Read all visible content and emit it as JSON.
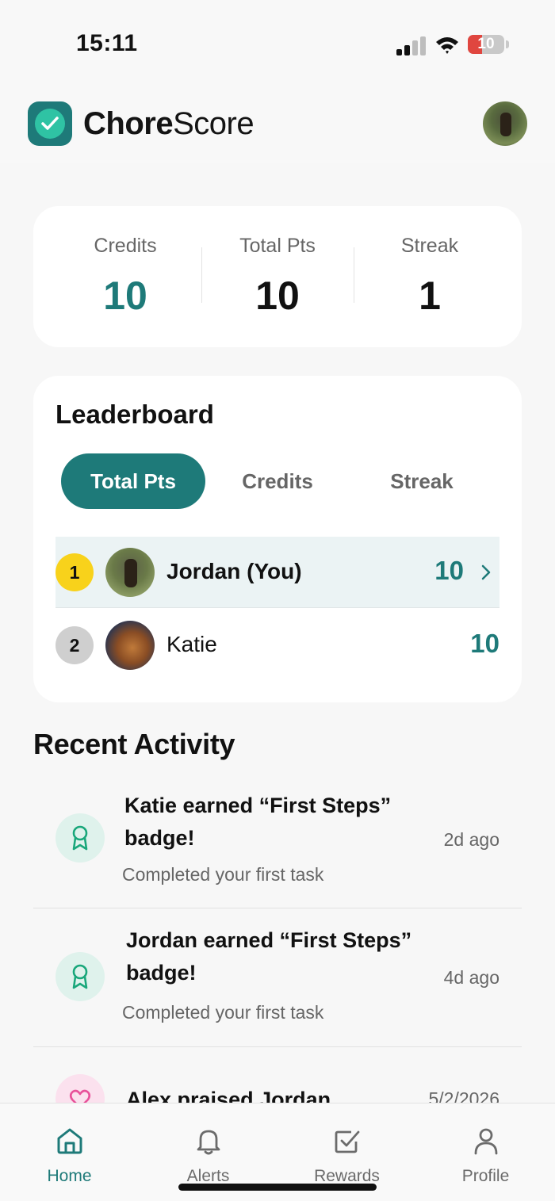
{
  "status_bar": {
    "time": "15:11",
    "battery_level": "10"
  },
  "app": {
    "title_bold": "Chore",
    "title_regular": "Score"
  },
  "stats": [
    {
      "label": "Credits",
      "value": "10"
    },
    {
      "label": "Total Pts",
      "value": "10"
    },
    {
      "label": "Streak",
      "value": "1"
    }
  ],
  "leaderboard": {
    "title": "Leaderboard",
    "tabs": [
      "Total Pts",
      "Credits",
      "Streak"
    ],
    "active_tab": "Total Pts",
    "rows": [
      {
        "rank": "1",
        "name": "Jordan (You)",
        "points": "10"
      },
      {
        "rank": "2",
        "name": "Katie",
        "points": "10"
      }
    ]
  },
  "recent_activity": {
    "title": "Recent Activity",
    "items": [
      {
        "icon": "award-icon",
        "title": "Katie earned “First Steps” badge!",
        "subtitle": "Completed your first task",
        "time": "2d ago"
      },
      {
        "icon": "award-icon",
        "title": "Jordan earned “First Steps” badge!",
        "subtitle": "Completed your first task",
        "time": "4d ago"
      },
      {
        "icon": "heart-icon",
        "title": "Alex praised Jordan",
        "time": "5/2/2026"
      }
    ]
  },
  "tab_bar": {
    "items": [
      {
        "label": "Home",
        "icon": "home-icon"
      },
      {
        "label": "Alerts",
        "icon": "bell-icon"
      },
      {
        "label": "Rewards",
        "icon": "checkbox-icon"
      },
      {
        "label": "Profile",
        "icon": "person-icon"
      }
    ],
    "active": "Home"
  },
  "colors": {
    "accent": "#1e7a79",
    "gold": "#f8d21b",
    "silver": "#cfcfcf"
  }
}
